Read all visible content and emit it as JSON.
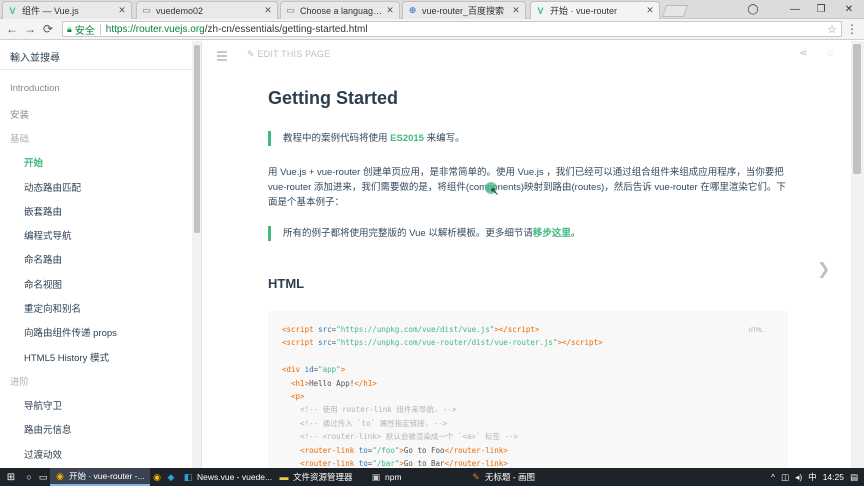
{
  "browser": {
    "tabs": [
      {
        "title": "组件 — Vue.js",
        "icon": "vue-logo"
      },
      {
        "title": "vuedemo02",
        "icon": "document"
      },
      {
        "title": "Choose a language · vu",
        "icon": "document"
      },
      {
        "title": "vue-router_百度搜索",
        "icon": "globe"
      },
      {
        "title": "开始 · vue-router",
        "icon": "vue-logo"
      }
    ],
    "secure_label": "安全",
    "url_host": "https://router.vuejs.org",
    "url_path": "/zh-cn/essentials/getting-started.html"
  },
  "sidebar": {
    "search_placeholder": "輸入並搜尋",
    "items": [
      {
        "label": "Introduction",
        "kind": "section"
      },
      {
        "label": "安装",
        "kind": "section"
      },
      {
        "label": "基础",
        "kind": "heading"
      },
      {
        "label": "开始",
        "kind": "active"
      },
      {
        "label": "动态路由匹配",
        "kind": "sub"
      },
      {
        "label": "嵌套路由",
        "kind": "sub"
      },
      {
        "label": "编程式导航",
        "kind": "sub"
      },
      {
        "label": "命名路由",
        "kind": "sub"
      },
      {
        "label": "命名视图",
        "kind": "sub"
      },
      {
        "label": "重定向和别名",
        "kind": "sub"
      },
      {
        "label": "向路由组件传递 props",
        "kind": "sub"
      },
      {
        "label": "HTML5 History 模式",
        "kind": "sub"
      },
      {
        "label": "进阶",
        "kind": "heading"
      },
      {
        "label": "导航守卫",
        "kind": "sub"
      },
      {
        "label": "路由元信息",
        "kind": "sub"
      },
      {
        "label": "过渡动效",
        "kind": "sub"
      }
    ]
  },
  "main": {
    "edit_link": "EDIT THIS PAGE",
    "title": "Getting Started",
    "tip1": {
      "before": "教程中的案例代码将使用 ",
      "link": "ES2015",
      "after": " 来编写。"
    },
    "paragraph": "用 Vue.js + vue-router 创建单页应用，是非常简单的。使用 Vue.js ，我们已经可以通过组合组件来组成应用程序，当你要把 vue-router 添加进来，我们需要做的是，将组件(components)映射到路由(routes)，然后告诉 vue-router 在哪里渲染它们。下面是个基本例子：",
    "tip2": {
      "before": "所有的例子都将使用完整版的 Vue 以解析模板。更多细节请",
      "link": "移步这里",
      "after": "。"
    },
    "section_heading": "HTML",
    "code_lang": "HTML",
    "code": {
      "line1_src": "\"https://unpkg.com/vue/dist/vue.js\"",
      "line2_src": "\"https://unpkg.com/vue-router/dist/vue-router.js\"",
      "app_id": "\"app\"",
      "h1_text": "Hello App!",
      "comment1": "<!-- 使用 router-link 组件来导航. -->",
      "comment2": "<!-- 通过传入 `to` 属性指定链接. -->",
      "comment3": "<!-- <router-link> 默认会被渲染成一个 `<a>` 标签 -->",
      "link1_to": "\"/foo\"",
      "link1_text": "Go to Foo",
      "link2_to": "\"/bar\"",
      "link2_text": "Go to Bar"
    }
  },
  "taskbar": {
    "items": [
      {
        "label": "开始 · vue-router -...",
        "icon": "chrome",
        "active": true
      },
      {
        "label": "News.vue - vuede...",
        "icon": "vscode"
      },
      {
        "label": "文件资源管理器",
        "icon": "folder"
      },
      {
        "label": "npm",
        "icon": "cmd"
      },
      {
        "label": "无标题 - 画图",
        "icon": "paint"
      }
    ],
    "ime": "中",
    "time": "14:25"
  }
}
